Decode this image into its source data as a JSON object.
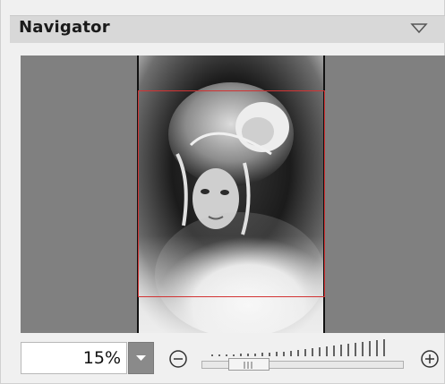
{
  "panel": {
    "title": "Navigator",
    "collapse_icon": "triangle-down-icon"
  },
  "zoom": {
    "value": "15%",
    "level_fraction": 0.15,
    "dropdown_icon": "triangle-down-icon",
    "minus_icon": "circle-minus-icon",
    "plus_icon": "circle-plus-icon"
  },
  "colors": {
    "viewport_border": "#d23434",
    "canvas_background": "#808080"
  }
}
